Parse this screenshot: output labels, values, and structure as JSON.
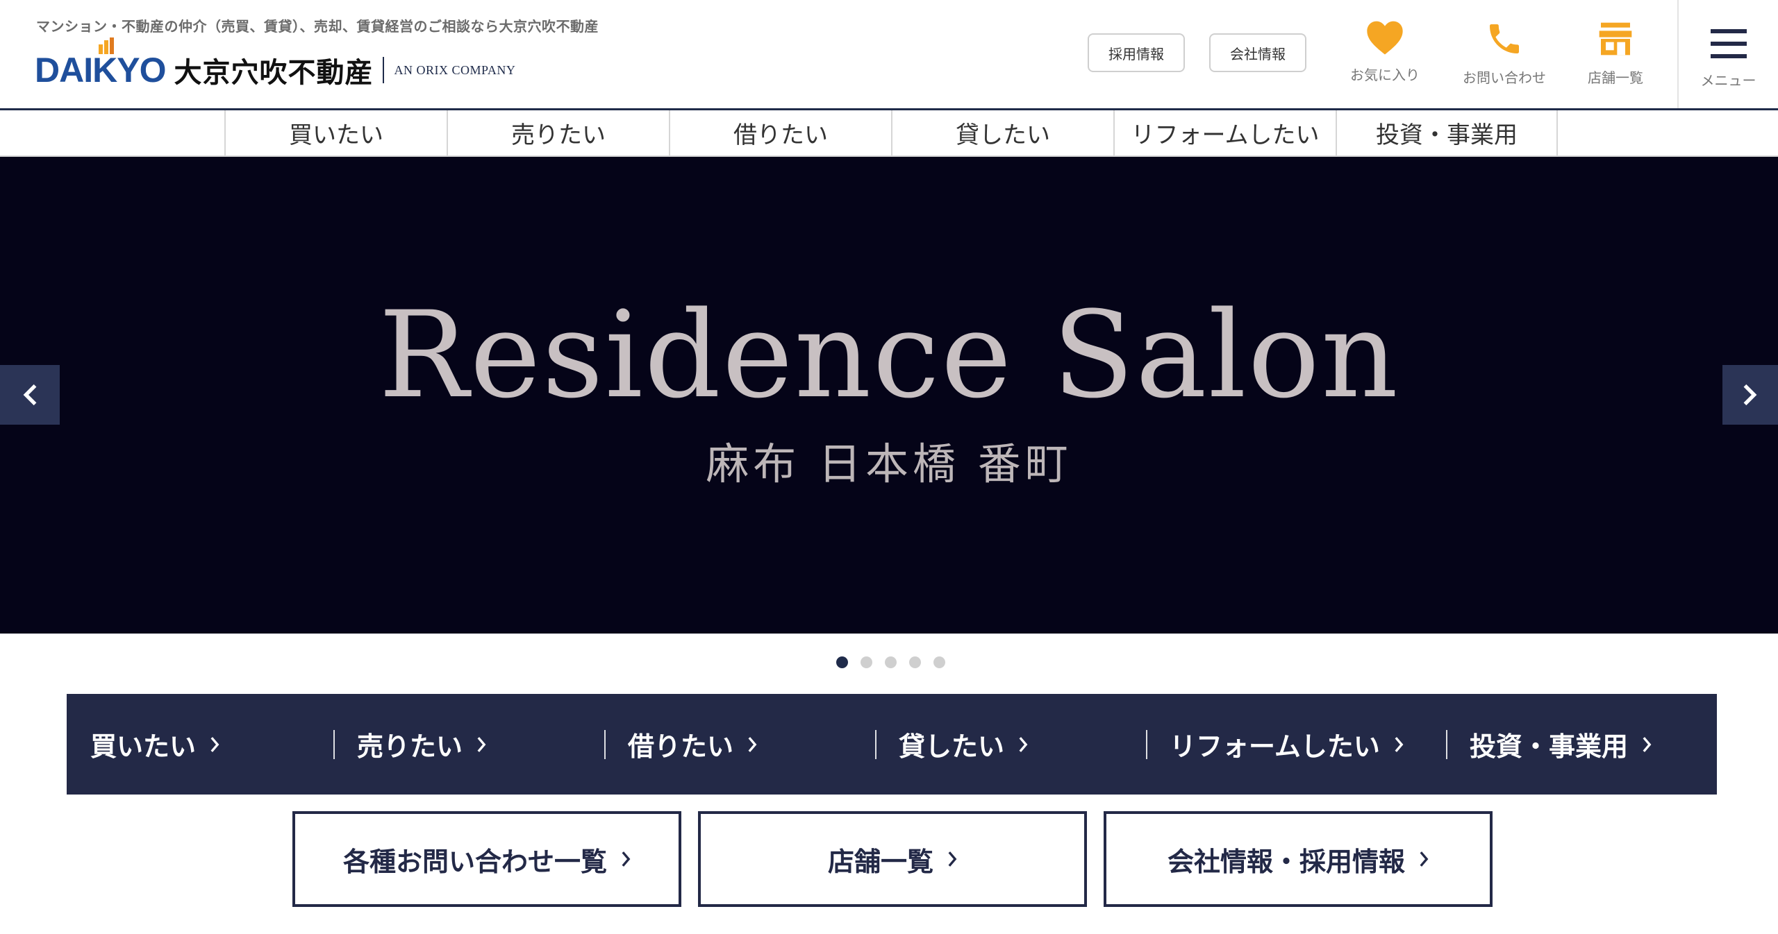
{
  "header": {
    "tagline": "マンション・不動産の仲介（売買、賃貸）、売却、賃貸経営のご相談なら大京穴吹不動産",
    "logo_mark": "DAIKYO",
    "logo_jp": "大京穴吹不動産",
    "logo_orix": "AN ORIX COMPANY",
    "buttons": {
      "recruit": "採用情報",
      "company": "会社情報"
    },
    "icons": {
      "favorites": "お気に入り",
      "contact": "お問い合わせ",
      "stores": "店舗一覧",
      "menu": "メニュー"
    },
    "icon_names": {
      "favorites": "heart-icon",
      "contact": "phone-icon",
      "stores": "store-icon",
      "menu": "hamburger-icon"
    },
    "colors": {
      "icon_orange": "#f5a623",
      "navy": "#232947",
      "logo_blue": "#1f4f9c"
    }
  },
  "topnav": {
    "items": [
      "買いたい",
      "売りたい",
      "借りたい",
      "貸したい",
      "リフォームしたい",
      "投資・事業用"
    ]
  },
  "hero": {
    "title": "Residence Salon",
    "subtitle": "麻布 日本橋 番町",
    "slide_count": 5,
    "active_slide": 1
  },
  "categories": {
    "items": [
      "買いたい",
      "売りたい",
      "借りたい",
      "貸したい",
      "リフォームしたい",
      "投資・事業用"
    ]
  },
  "bottom": {
    "contact_list": "各種お問い合わせ一覧",
    "store_list": "店舗一覧",
    "company_recruit": "会社情報・採用情報"
  }
}
